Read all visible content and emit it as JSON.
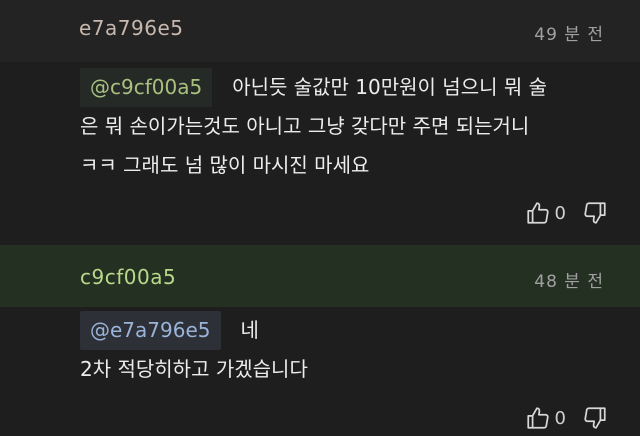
{
  "comments": [
    {
      "author": "e7a796e5",
      "time": "49 분 전",
      "mention": "@c9cf00a5",
      "text_line1": "아닌듯 술값만 10만원이 넘으니 뭐 술",
      "text_line2": "은 뭐 손이가는것도 아니고 그냥 갖다만 주면 되는거니",
      "text_line3": "ㅋㅋ 그래도 넘 많이 마시진 마세요",
      "likes": "0"
    },
    {
      "author": "c9cf00a5",
      "time": "48 분 전",
      "mention": "@e7a796e5",
      "text_line1": "네",
      "text_line2": "2차 적당히하고 가겠습니다",
      "likes": "0"
    }
  ],
  "icons": {
    "like": "thumbs-up-icon",
    "dislike": "thumbs-down-icon"
  }
}
